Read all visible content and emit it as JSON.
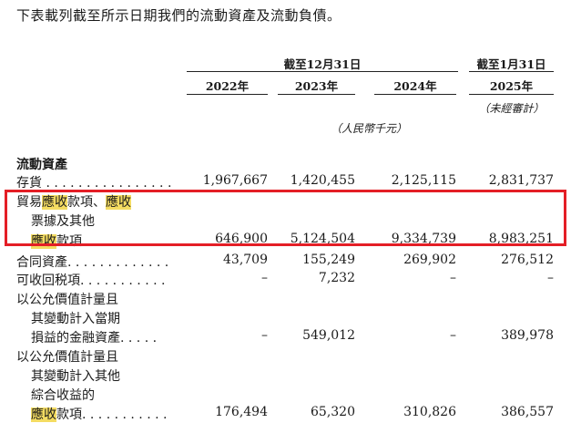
{
  "intro": "下表載列截至所示日期我們的流動資產及流動負債。",
  "headers": {
    "group_left": "截至12月31日",
    "group_right": "截至1月31日",
    "years": [
      "2022年",
      "2023年",
      "2024年",
      "2025年"
    ],
    "unaudited": "（未經審計）",
    "currency": "（人民幣千元）"
  },
  "section_title": "流動資產",
  "rows": [
    {
      "lines": [
        "存貨 . . . . . . . . . . . . . . . ."
      ],
      "values": [
        "1,967,667",
        "1,420,455",
        "2,125,115",
        "2,831,737"
      ]
    },
    {
      "lines": [
        "貿易應收款項、應收",
        "票據及其他",
        "應收款項. . . . . . . . . . ."
      ],
      "values": [
        "646,900",
        "5,124,504",
        "9,334,739",
        "8,983,251"
      ]
    },
    {
      "lines": [
        "合同資產. . . . . . . . . . . . ."
      ],
      "values": [
        "43,709",
        "155,249",
        "269,902",
        "276,512"
      ]
    },
    {
      "lines": [
        "可收回税項. . . . . . . . . . ."
      ],
      "values": [
        "–",
        "7,232",
        "–",
        "–"
      ]
    },
    {
      "lines": [
        "以公允價值計量且",
        "其變動計入當期",
        "損益的金融資產. . . . ."
      ],
      "values": [
        "–",
        "549,012",
        "–",
        "389,978"
      ]
    },
    {
      "lines": [
        "以公允價值計量且",
        "其變動計入其他",
        "綜合收益的",
        "應收款項. . . . . . . . . . ."
      ],
      "values": [
        "176,494",
        "65,320",
        "310,826",
        "386,557"
      ]
    }
  ],
  "colors": {
    "highlight": "#f4dc62",
    "box": "#e41e26"
  }
}
